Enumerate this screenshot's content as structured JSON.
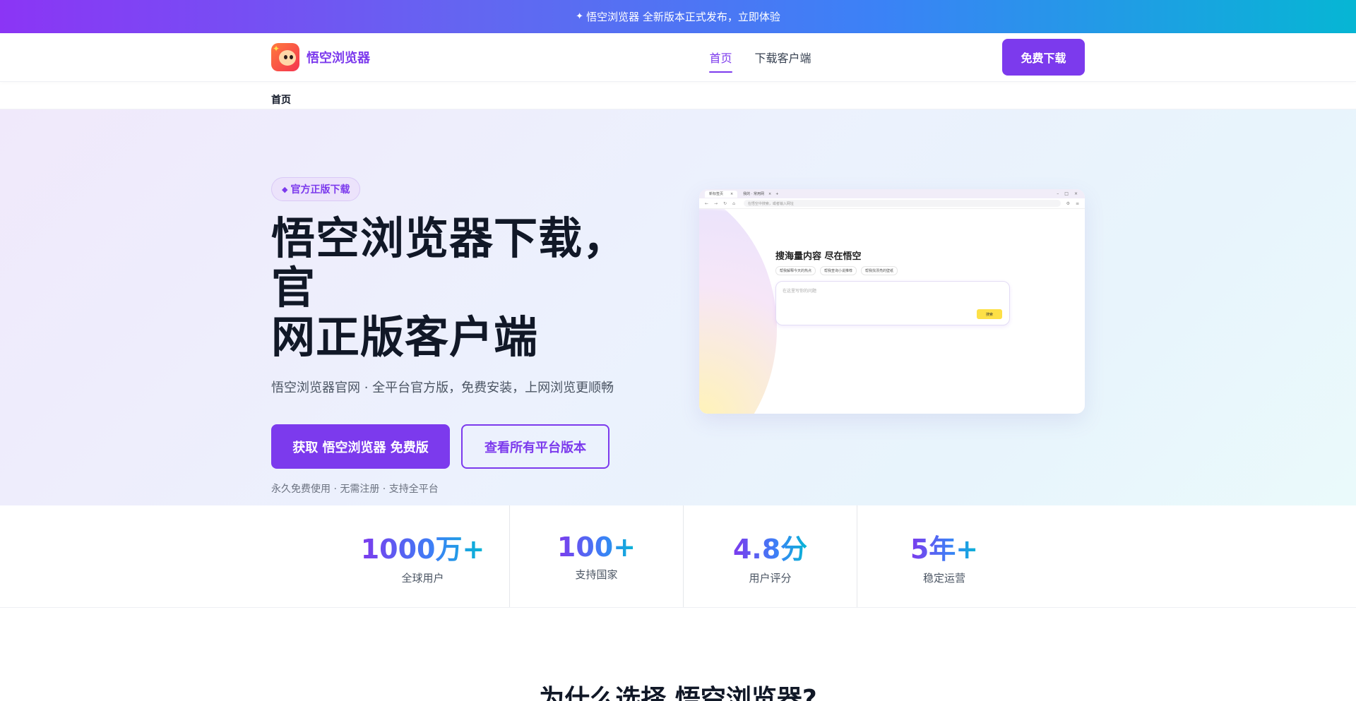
{
  "announcement": {
    "icon": "sparkle-icon",
    "text": "悟空浏览器 全新版本正式发布，立即体验"
  },
  "nav": {
    "brand_name": "悟空浏览器",
    "links": [
      {
        "label": "首页",
        "active": true
      },
      {
        "label": "下载客户端",
        "active": false
      }
    ],
    "cta": "免费下载"
  },
  "breadcrumb": {
    "current": "首页"
  },
  "hero": {
    "badge": "官方正版下载",
    "title_line1": "悟空浏览器下载，官",
    "title_line2": "网正版客户端",
    "subtitle": "悟空浏览器官网 · 全平台官方版，免费安装，上网浏览更顺畅",
    "primary_button": "获取 悟空浏览器 免费版",
    "secondary_button": "查看所有平台版本",
    "note": "永久免费使用 · 无需注册 · 支持全平台",
    "mock": {
      "tab1": "新标签页",
      "tab2": "我的 · 常用网",
      "address_placeholder": "在悟空中搜索，或者输入网址",
      "heading": "搜海量内容 尽在悟空",
      "chips": [
        "帮我解释今天的热点",
        "帮我查询小说推荐",
        "帮我找漂亮的壁纸"
      ],
      "search_placeholder": "在这里写你的问题",
      "search_button": "搜索"
    }
  },
  "stats": [
    {
      "value": "1000万+",
      "label": "全球用户"
    },
    {
      "value": "100+",
      "label": "支持国家"
    },
    {
      "value": "4.8分",
      "label": "用户评分"
    },
    {
      "value": "5年+",
      "label": "稳定运营"
    }
  ],
  "why": {
    "title": "为什么选择 悟空浏览器?"
  },
  "colors": {
    "accent": "#7c3aed",
    "gradient_start": "#8b35f5",
    "gradient_end": "#06b6d4"
  }
}
